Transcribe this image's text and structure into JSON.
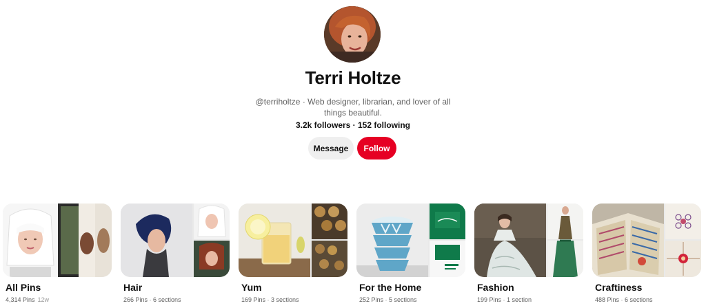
{
  "profile": {
    "name": "Terri Holtze",
    "bio": "@terriholtze · Web designer, librarian, and lover of all things beautiful.",
    "stats": "3.2k followers · 152 following",
    "message_label": "Message",
    "follow_label": "Follow"
  },
  "colors": {
    "follow_bg": "#e60023",
    "message_bg": "#efefef"
  },
  "boards": [
    {
      "title": "All Pins",
      "meta": "4,314 Pins",
      "age": "12w"
    },
    {
      "title": "Hair",
      "meta": "266 Pins · 6 sections"
    },
    {
      "title": "Yum",
      "meta": "169 Pins · 3 sections"
    },
    {
      "title": "For the Home",
      "meta": "252 Pins · 5 sections"
    },
    {
      "title": "Fashion",
      "meta": "199 Pins · 1 section"
    },
    {
      "title": "Craftiness",
      "meta": "488 Pins · 6 sections"
    }
  ]
}
